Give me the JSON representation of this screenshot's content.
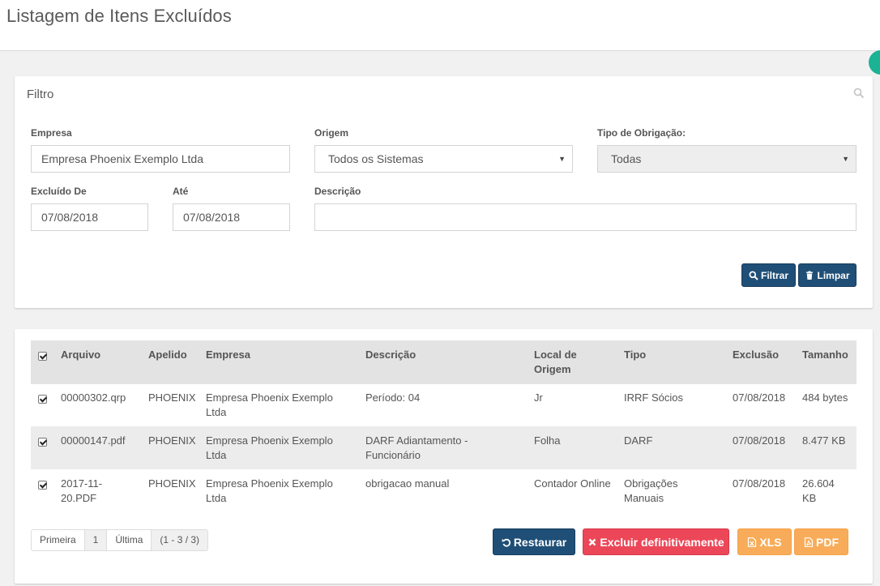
{
  "page": {
    "title": "Listagem de Itens Excluídos"
  },
  "filter": {
    "title": "Filtro",
    "empresa_label": "Empresa",
    "empresa_value": "Empresa Phoenix Exemplo Ltda",
    "origem_label": "Origem",
    "origem_value": "Todos os Sistemas",
    "tipo_label": "Tipo de Obrigação:",
    "tipo_value": "Todas",
    "excluido_de_label": "Excluído De",
    "excluido_de_value": "07/08/2018",
    "ate_label": "Até",
    "ate_value": "07/08/2018",
    "descricao_label": "Descrição",
    "descricao_value": "",
    "filtrar_label": "Filtrar",
    "limpar_label": "Limpar"
  },
  "table": {
    "headers": {
      "arquivo": "Arquivo",
      "apelido": "Apelido",
      "empresa": "Empresa",
      "descricao": "Descrição",
      "local_l1": "Local de",
      "local_l2": "Origem",
      "tipo": "Tipo",
      "exclusao": "Exclusão",
      "tamanho": "Tamanho"
    },
    "rows": [
      {
        "arquivo_l1": "00000302.qrp",
        "arquivo_l2": "",
        "apelido": "PHOENIX",
        "empresa_l1": "Empresa Phoenix Exemplo",
        "empresa_l2": "Ltda",
        "descricao_l1": "Período: 04",
        "descricao_l2": "",
        "local": "Jr",
        "tipo_l1": "IRRF Sócios",
        "tipo_l2": "",
        "exclusao": "07/08/2018",
        "tamanho_l1": "484 bytes",
        "tamanho_l2": ""
      },
      {
        "arquivo_l1": "00000147.pdf",
        "arquivo_l2": "",
        "apelido": "PHOENIX",
        "empresa_l1": "Empresa Phoenix Exemplo",
        "empresa_l2": "Ltda",
        "descricao_l1": "DARF Adiantamento -",
        "descricao_l2": "Funcionário",
        "local": "Folha",
        "tipo_l1": "DARF",
        "tipo_l2": "",
        "exclusao": "07/08/2018",
        "tamanho_l1": "8.477 KB",
        "tamanho_l2": ""
      },
      {
        "arquivo_l1": "2017-11-",
        "arquivo_l2": "20.PDF",
        "apelido": "PHOENIX",
        "empresa_l1": "Empresa Phoenix Exemplo",
        "empresa_l2": "Ltda",
        "descricao_l1": "obrigacao manual",
        "descricao_l2": "",
        "local": "Contador Online",
        "tipo_l1": "Obrigações",
        "tipo_l2": "Manuais",
        "exclusao": "07/08/2018",
        "tamanho_l1": "26.604",
        "tamanho_l2": "KB"
      }
    ]
  },
  "pager": {
    "first": "Primeira",
    "page": "1",
    "last": "Última",
    "range": "(1 - 3 / 3)"
  },
  "actions": {
    "restaurar": "Restaurar",
    "excluir": "Excluir definitivamente",
    "xls": "XLS",
    "pdf": "PDF"
  },
  "colors": {
    "navy": "#1f4f77",
    "red": "#ec4758",
    "orange": "#f8ac59",
    "teal": "#1ab394"
  }
}
